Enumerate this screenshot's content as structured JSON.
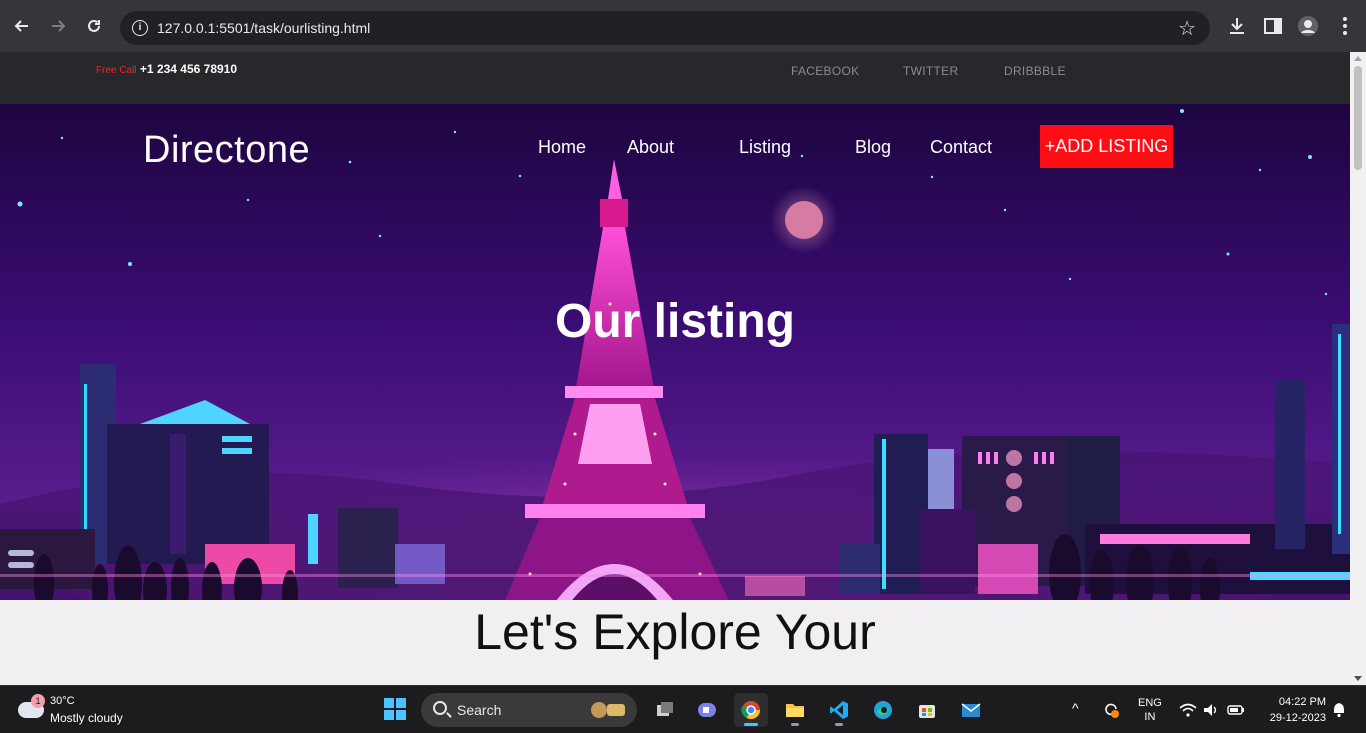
{
  "browser": {
    "url": "127.0.0.1:5501/task/ourlisting.html",
    "back_icon": "arrow-left-icon",
    "forward_icon": "arrow-right-icon",
    "reload_icon": "reload-icon",
    "bookmark_icon": "star-icon"
  },
  "topbar": {
    "free_call_label": "Free Call",
    "phone": "+1 234 456 78910",
    "social": [
      "FACEBOOK",
      "TWITTER",
      "DRIBBBLE"
    ]
  },
  "header": {
    "brand": "Directone",
    "menu": [
      "Home",
      "About",
      "Listing",
      "Blog",
      "Contact"
    ],
    "cta": "+ADD LISTING"
  },
  "hero": {
    "title": "Our listing"
  },
  "explore": {
    "heading": "Let's Explore Your"
  },
  "colors": {
    "cta_bg": "#ff0d14",
    "free_call": "#ff2020",
    "hero_sky": "#3a0a6b",
    "accent_pink": "#e22bd1"
  },
  "taskbar": {
    "weather_badge": "1",
    "temperature": "30°C",
    "condition": "Mostly cloudy",
    "search_label": "Search",
    "language_line1": "ENG",
    "language_line2": "IN",
    "time": "04:22 PM",
    "date": "29-12-2023"
  }
}
